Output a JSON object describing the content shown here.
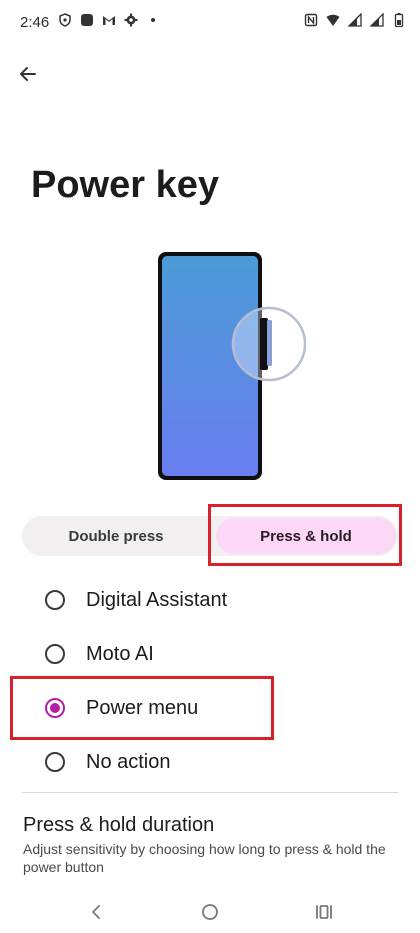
{
  "status_bar": {
    "time": "2:46",
    "left_icons": [
      "shield-icon",
      "app-square-icon",
      "gmail-icon",
      "gear-icon",
      "dot-icon"
    ],
    "right_icons": [
      "nfc-icon",
      "wifi-icon",
      "signal-icon",
      "signal-icon",
      "battery-icon"
    ]
  },
  "header": {
    "back_icon": "back-arrow-icon"
  },
  "page": {
    "title": "Power key"
  },
  "illustration": {
    "icon": "phone-illustration"
  },
  "tabs": [
    {
      "label": "Double press",
      "selected": false
    },
    {
      "label": "Press & hold",
      "selected": true
    }
  ],
  "options": [
    {
      "label": "Digital Assistant",
      "selected": false
    },
    {
      "label": "Moto AI",
      "selected": false
    },
    {
      "label": "Power menu",
      "selected": true
    },
    {
      "label": "No action",
      "selected": false
    }
  ],
  "duration": {
    "title": "Press & hold duration",
    "description": "Adjust sensitivity by choosing how long to press & hold the power button"
  },
  "colors": {
    "accent": "#b21fa6",
    "selected_tab_bg": "#fbd8f5",
    "highlight_red": "#d8202b"
  },
  "nav_bar": {
    "icons": [
      "nav-back-icon",
      "nav-home-icon",
      "nav-recents-icon"
    ]
  }
}
